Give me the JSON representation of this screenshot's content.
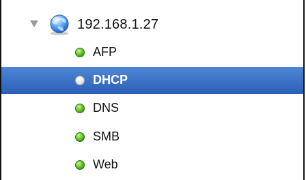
{
  "source_list": {
    "server": {
      "address": "192.168.1.27",
      "expanded": true,
      "icon": "globe-icon",
      "disclosure_icon": "disclosure-triangle-expanded-icon"
    },
    "services": [
      {
        "label": "AFP",
        "status": "running",
        "status_color": "#5fc12a",
        "selected": false
      },
      {
        "label": "DHCP",
        "status": "stopped",
        "status_color": "#e8e8e8",
        "selected": true
      },
      {
        "label": "DNS",
        "status": "running",
        "status_color": "#5fc12a",
        "selected": false
      },
      {
        "label": "SMB",
        "status": "running",
        "status_color": "#5fc12a",
        "selected": false
      },
      {
        "label": "Web",
        "status": "running",
        "status_color": "#5fc12a",
        "selected": false
      }
    ],
    "selection_color": "#3a6fc4"
  }
}
